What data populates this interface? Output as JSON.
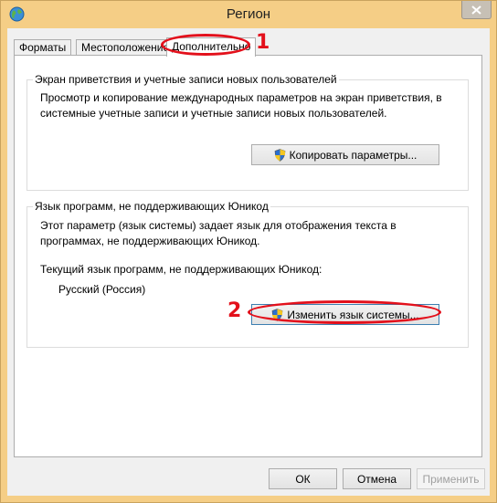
{
  "window": {
    "title": "Регион",
    "accent_color": "#f5ce86"
  },
  "tabs": [
    {
      "label": "Форматы",
      "active": false
    },
    {
      "label": "Местоположение",
      "active": false
    },
    {
      "label": "Дополнительно",
      "active": true
    }
  ],
  "welcome_group": {
    "title": "Экран приветствия и учетные записи новых пользователей",
    "description_line1": "Просмотр и копирование международных параметров на экран приветствия, в",
    "description_line2": "системные учетные записи и учетные записи новых пользователей.",
    "copy_button_label": "Копировать параметры...",
    "copy_button_icon": "uac-shield-icon"
  },
  "unicode_group": {
    "title": "Язык программ, не поддерживающих Юникод",
    "description_line1": "Этот параметр (язык системы) задает язык для отображения текста в",
    "description_line2": "программах, не поддерживающих Юникод.",
    "current_label": "Текущий язык программ, не поддерживающих Юникод:",
    "current_value": "Русский (Россия)",
    "change_button_label": "Изменить язык системы...",
    "change_button_icon": "uac-shield-icon"
  },
  "annotations": {
    "marker_1": "1",
    "marker_2": "2",
    "color": "#e3101b"
  },
  "footer": {
    "ok_label": "ОК",
    "cancel_label": "Отмена",
    "apply_label": "Применить",
    "apply_enabled": false
  }
}
